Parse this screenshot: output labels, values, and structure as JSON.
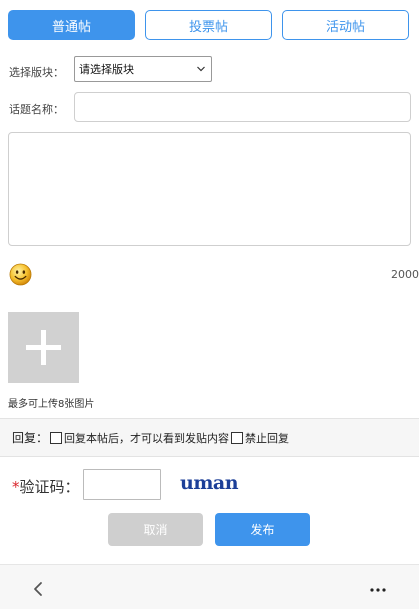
{
  "tabs": [
    {
      "label": "普通帖",
      "active": true
    },
    {
      "label": "投票帖",
      "active": false
    },
    {
      "label": "活动帖",
      "active": false
    }
  ],
  "form": {
    "section_label": "选择版块：",
    "section_select_value": "请选择版块",
    "topic_label": "话题名称："
  },
  "editor": {
    "char_counter": "2000",
    "emoji_icon": "smiley-icon"
  },
  "upload": {
    "hint": "最多可上传8张图片"
  },
  "reply": {
    "label": "回复：",
    "option_reply_to_view": "回复本帖后，才可以看到发贴内容",
    "option_disable_reply": "禁止回复"
  },
  "captcha": {
    "required_mark": "*",
    "label": "验证码：",
    "image_text": "uman"
  },
  "actions": {
    "cancel_label": "取消",
    "publish_label": "发布"
  },
  "bottom_bar": {
    "back_icon": "chevron-left-icon",
    "more_icon": "more-dots-icon"
  },
  "colors": {
    "accent": "#3e94ec",
    "disabled": "#cfcfcf",
    "required": "#d9262c",
    "captcha_text": "#1c3f98"
  }
}
